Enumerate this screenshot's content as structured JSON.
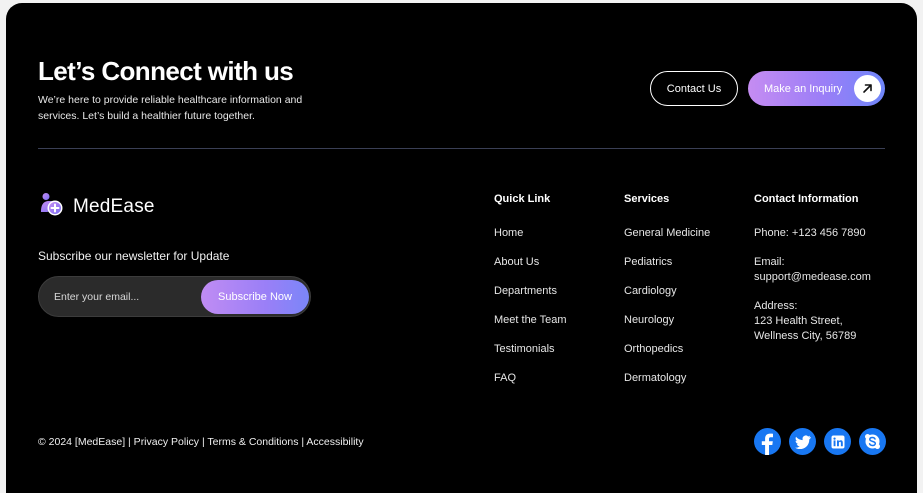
{
  "cta": {
    "title": "Let’s Connect with us",
    "subtitle": "We’re here to provide reliable healthcare information and services. Let’s build a healthier future together.",
    "contact_label": "Contact Us",
    "inquiry_label": "Make an Inquiry",
    "inquiry_icon": "arrow-up-right-icon"
  },
  "brand": {
    "name": "MedEase",
    "logo_icon": "medical-plus-icon"
  },
  "newsletter": {
    "title": "Subscribe our newsletter for Update",
    "placeholder": "Enter your email...",
    "button_label": "Subscribe Now"
  },
  "quick_links": {
    "title": "Quick Link",
    "items": [
      "Home",
      "About Us",
      "Departments",
      "Meet the Team",
      "Testimonials",
      "FAQ"
    ]
  },
  "services": {
    "title": "Services",
    "items": [
      "General Medicine",
      "Pediatrics",
      "Cardiology",
      "Neurology",
      "Orthopedics",
      "Dermatology"
    ]
  },
  "contact_info": {
    "title": "Contact Information",
    "phone": "Phone: +123 456 7890",
    "email_label": "Email:",
    "email": "support@medease.com",
    "address_label": "Address:",
    "address_line1": "123 Health Street,",
    "address_line2": "Wellness City, 56789"
  },
  "footer": {
    "copyright": "© 2024 [MedEase] | Privacy Policy | Terms & Conditions | Accessibility"
  },
  "socials": [
    {
      "name": "facebook-icon"
    },
    {
      "name": "twitter-icon"
    },
    {
      "name": "linkedin-icon"
    },
    {
      "name": "skype-icon"
    }
  ],
  "colors": {
    "background": "#000000",
    "accent_start": "#c58cf2",
    "accent_end": "#6f86f9",
    "social": "#1877f2"
  }
}
